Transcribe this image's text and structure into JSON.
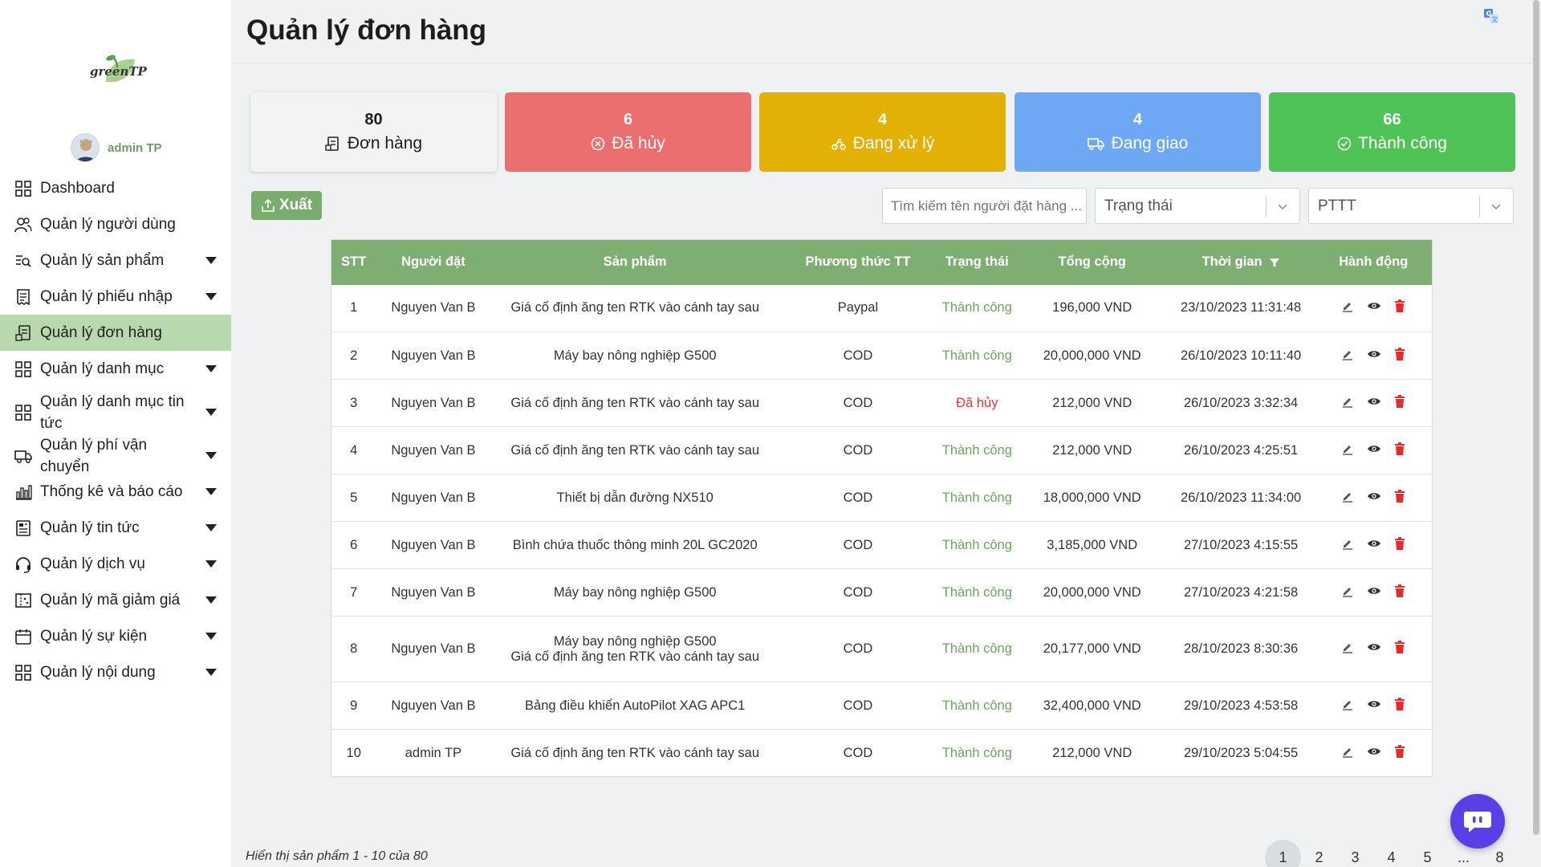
{
  "app": {
    "logo_text": "greenTP",
    "user_name": "admin TP"
  },
  "sidebar": {
    "items": [
      {
        "label": "Dashboard",
        "icon": "dashboard-icon",
        "has_caret": false
      },
      {
        "label": "Quản lý người dùng",
        "icon": "users-icon",
        "has_caret": false
      },
      {
        "label": "Quản lý sản phẩm",
        "icon": "product-search-icon",
        "has_caret": true
      },
      {
        "label": "Quản lý phiếu nhập",
        "icon": "receipt-icon",
        "has_caret": true
      },
      {
        "label": "Quản lý đơn hàng",
        "icon": "order-icon",
        "has_caret": false,
        "active": true
      },
      {
        "label": "Quản lý danh mục",
        "icon": "grid-icon",
        "has_caret": true
      },
      {
        "label": "Quản lý danh mục tin tức",
        "icon": "grid-icon",
        "has_caret": true
      },
      {
        "label": "Quản lý phí vận chuyển",
        "icon": "truck-icon",
        "has_caret": true
      },
      {
        "label": "Thống kê và báo cáo",
        "icon": "chart-icon",
        "has_caret": true
      },
      {
        "label": "Quản lý tin tức",
        "icon": "news-icon",
        "has_caret": true
      },
      {
        "label": "Quản lý dịch vụ",
        "icon": "headset-icon",
        "has_caret": true
      },
      {
        "label": "Quản lý mã giảm giá",
        "icon": "coupon-icon",
        "has_caret": true
      },
      {
        "label": "Quản lý sự kiện",
        "icon": "calendar-icon",
        "has_caret": true
      },
      {
        "label": "Quản lý nội dung",
        "icon": "grid-icon",
        "has_caret": true
      }
    ]
  },
  "header": {
    "title": "Quản lý đơn hàng"
  },
  "stats": {
    "total": {
      "value": "80",
      "label": "Đơn hàng"
    },
    "cancelled": {
      "value": "6",
      "label": "Đã hủy"
    },
    "processing": {
      "value": "4",
      "label": "Đang xử lý"
    },
    "shipping": {
      "value": "4",
      "label": "Đang giao"
    },
    "success": {
      "value": "66",
      "label": "Thành công"
    }
  },
  "toolbar": {
    "export_label": "Xuất",
    "search_placeholder": "Tìm kiếm tên người đặt hàng ...",
    "status_select": "Trạng thái",
    "method_select": "PTTT"
  },
  "table": {
    "headers": [
      "STT",
      "Người đặt",
      "Sản phẩm",
      "Phương thức TT",
      "Trạng thái",
      "Tổng cộng",
      "Thời gian",
      "Hành động"
    ],
    "rows": [
      {
        "stt": "1",
        "customer": "Nguyen Van B",
        "products": [
          "Giá cố định ăng ten RTK vào cánh tay sau"
        ],
        "method": "Paypal",
        "status": "Thành công",
        "status_type": "ok",
        "total": "196,000 VND",
        "time": "23/10/2023 11:31:48"
      },
      {
        "stt": "2",
        "customer": "Nguyen Van B",
        "products": [
          "Máy bay nông nghiệp G500"
        ],
        "method": "COD",
        "status": "Thành công",
        "status_type": "ok",
        "total": "20,000,000 VND",
        "time": "26/10/2023 10:11:40"
      },
      {
        "stt": "3",
        "customer": "Nguyen Van B",
        "products": [
          "Giá cố định ăng ten RTK vào cánh tay sau"
        ],
        "method": "COD",
        "status": "Đã hủy",
        "status_type": "cancel",
        "total": "212,000 VND",
        "time": "26/10/2023 3:32:34"
      },
      {
        "stt": "4",
        "customer": "Nguyen Van B",
        "products": [
          "Giá cố định ăng ten RTK vào cánh tay sau"
        ],
        "method": "COD",
        "status": "Thành công",
        "status_type": "ok",
        "total": "212,000 VND",
        "time": "26/10/2023 4:25:51"
      },
      {
        "stt": "5",
        "customer": "Nguyen Van B",
        "products": [
          "Thiết bị dẫn đường NX510"
        ],
        "method": "COD",
        "status": "Thành công",
        "status_type": "ok",
        "total": "18,000,000 VND",
        "time": "26/10/2023 11:34:00"
      },
      {
        "stt": "6",
        "customer": "Nguyen Van B",
        "products": [
          "Bình chứa thuốc thông minh 20L GC2020"
        ],
        "method": "COD",
        "status": "Thành công",
        "status_type": "ok",
        "total": "3,185,000 VND",
        "time": "27/10/2023 4:15:55"
      },
      {
        "stt": "7",
        "customer": "Nguyen Van B",
        "products": [
          "Máy bay nông nghiệp G500"
        ],
        "method": "COD",
        "status": "Thành công",
        "status_type": "ok",
        "total": "20,000,000 VND",
        "time": "27/10/2023 4:21:58"
      },
      {
        "stt": "8",
        "customer": "Nguyen Van B",
        "products": [
          "Máy bay nông nghiệp G500",
          "Giá cố định ăng ten RTK vào cánh tay sau"
        ],
        "method": "COD",
        "status": "Thành công",
        "status_type": "ok",
        "total": "20,177,000 VND",
        "time": "28/10/2023 8:30:36"
      },
      {
        "stt": "9",
        "customer": "Nguyen Van B",
        "products": [
          "Bảng điều khiển AutoPilot XAG APC1"
        ],
        "method": "COD",
        "status": "Thành công",
        "status_type": "ok",
        "total": "32,400,000 VND",
        "time": "29/10/2023 4:53:58"
      },
      {
        "stt": "10",
        "customer": "admin TP",
        "products": [
          "Giá cố định ăng ten RTK vào cánh tay sau"
        ],
        "method": "COD",
        "status": "Thành công",
        "status_type": "ok",
        "total": "212,000 VND",
        "time": "29/10/2023 5:04:55"
      }
    ]
  },
  "footer": {
    "summary": "Hiển thị sản phẩm 1 - 10 của 80",
    "pages": [
      "1",
      "2",
      "3",
      "4",
      "5",
      "...",
      "8"
    ],
    "current_page": "1"
  },
  "colors": {
    "accent_green": "#7fae73",
    "active_nav": "#b7d9ad",
    "cancel_red": "#ec6f6f",
    "processing_yellow": "#e3b004",
    "shipping_blue": "#6ea8f5",
    "success_green": "#4fc355",
    "chat_purple": "#5b3fe6"
  }
}
